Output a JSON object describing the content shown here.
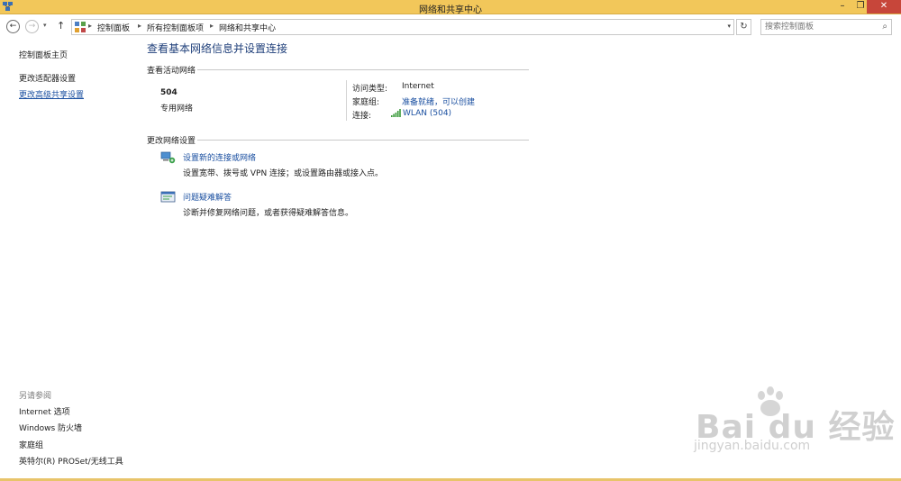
{
  "window": {
    "title": "网络和共享中心",
    "minimize": "–",
    "maximize": "❐",
    "close": "✕"
  },
  "nav": {
    "back": "←",
    "forward": "→",
    "recent": "▾",
    "up": "↑",
    "breadcrumbs": [
      "控制面板",
      "所有控制面板项",
      "网络和共享中心"
    ],
    "separator": "▸",
    "refresh": "↻",
    "search_placeholder": "搜索控制面板",
    "address_dropdown": "▾"
  },
  "sidebar": {
    "items": [
      {
        "label": "控制面板主页"
      },
      {
        "label": "更改适配器设置"
      },
      {
        "label": "更改高级共享设置"
      }
    ],
    "see_also_heading": "另请参阅",
    "see_also": [
      {
        "label": "Internet 选项"
      },
      {
        "label": "Windows 防火墙"
      },
      {
        "label": "家庭组"
      },
      {
        "label": "英特尔(R) PROSet/无线工具"
      }
    ]
  },
  "main": {
    "title": "查看基本网络信息并设置连接",
    "active_section": "查看活动网络",
    "network": {
      "name": "504",
      "type": "专用网络",
      "access_type_label": "访问类型:",
      "access_type_value": "Internet",
      "homegroup_label": "家庭组:",
      "homegroup_value": "准备就绪，可以创建",
      "connection_label": "连接:",
      "connection_value": "WLAN (504)"
    },
    "change_section": "更改网络设置",
    "tasks": [
      {
        "link": "设置新的连接或网络",
        "desc": "设置宽带、拨号或 VPN 连接；或设置路由器或接入点。"
      },
      {
        "link": "问题疑难解答",
        "desc": "诊断并修复网络问题，或者获得疑难解答信息。"
      }
    ]
  },
  "watermark": {
    "logo": "Bai du 经验",
    "url": "jingyan.baidu.com"
  },
  "colors": {
    "titlebar": "#f2c75a",
    "link": "#1a4fa0",
    "title_blue": "#1f3f7a"
  }
}
